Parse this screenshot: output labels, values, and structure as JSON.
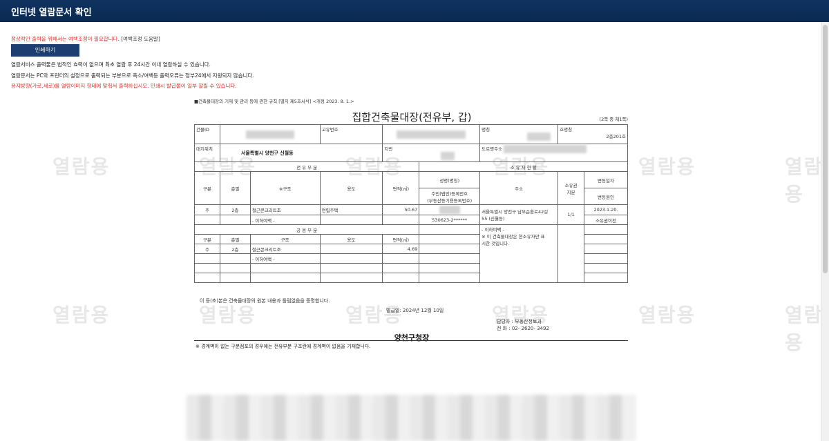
{
  "window": {
    "title": "인터넷 열람문서 확인"
  },
  "notice": {
    "margin_warning": "정상적인 출력을 위해서는 여백조정이 필요합니다.",
    "margin_help_link": "[여백조정 도움말]",
    "print_button": "인쇄하기",
    "line1": "열람서비스 출력물은 법적인 효력이 없으며 최초 열람 후 24시간 이내 열람하실 수 있습니다.",
    "line2": "열람문서는 PC와 프린터의 설정으로 출력되는 부분으로 축소/여백등 출력오류는 정부24에서 지원되지 않습니다.",
    "line3": "용지방향(가로,세로)를 열람이미지 형태에 맞춰서 출력하십시오. 인쇄시 발급물이 일부 잘릴 수 있습니다."
  },
  "watermark": "열람용",
  "document": {
    "regulation_note": "■건축물대장의 기재 및 관리 등에 관한 규칙 [별지 제5호서식] <개정 2023. 8. 1.>",
    "title": "집합건축물대장(전유부, 갑)",
    "page_indicator": "(2쪽 중 제1쪽)",
    "header": {
      "building_id_label": "건물ID",
      "unique_no_label": "고유번호",
      "name_label": "명칭",
      "unit_name_label": "호명칭",
      "unit_name_value": "2층201호",
      "location_label": "대지위치",
      "location_value": "서울특별시 양천구 신월동",
      "lot_label": "지번",
      "road_address_label": "도로명주소"
    },
    "exclusive_section": "전 유 부 분",
    "owner_section": "소 유 자 현 황",
    "cols": {
      "type": "구분",
      "floor": "층별",
      "structure_mark": "※구조",
      "structure": "구조",
      "use": "용도",
      "area": "면적(㎡)",
      "owner_name": "성명(명칭)",
      "owner_reg": "주민(법인)등록번호",
      "owner_reg2": "(부동산등기용등록번호)",
      "address": "주소",
      "share_a": "소유권",
      "share_b": "지분",
      "change_date": "변동일자",
      "change_reason": "변동원인"
    },
    "exclusive_row": {
      "type": "주",
      "floor": "2층",
      "structure": "철근콘크리트조",
      "use": "연립주택",
      "area": "50.67",
      "sub": "- 이하여백 -"
    },
    "owner_row": {
      "reg_no": "530623-2******",
      "address1": "서울특별시 양천구 남부순환로42길",
      "address2": "55 (신월동)",
      "share": "1/1",
      "date": "2023.1.20.",
      "reason": "소유권이전",
      "blank": "- 이하여백 -",
      "note1": "※ 이 건축물대장은 현소유자만 표",
      "note2": "시한 것입니다."
    },
    "common_section": "공 용 부 분",
    "common_row": {
      "type": "주",
      "floor": "2층",
      "structure": "철근콘크리트조",
      "area": "4.69",
      "sub": "- 이하여백 -"
    },
    "footer": {
      "certification": "이 등(초)본은 건축물대장의 원본 내용과 틀림없음을 증명합니다.",
      "issue_date": "발급일: 2024년 12월 10일",
      "officer": "담당자 : 부동산정보과",
      "phone": "전    화 : 02- 2620- 3492",
      "issuer": "양천구청장",
      "note": "※ 경계벽이 없는 구분점포의 경우에는 전유부분 구조란에 경계벽이 없음을 기재합니다."
    }
  }
}
